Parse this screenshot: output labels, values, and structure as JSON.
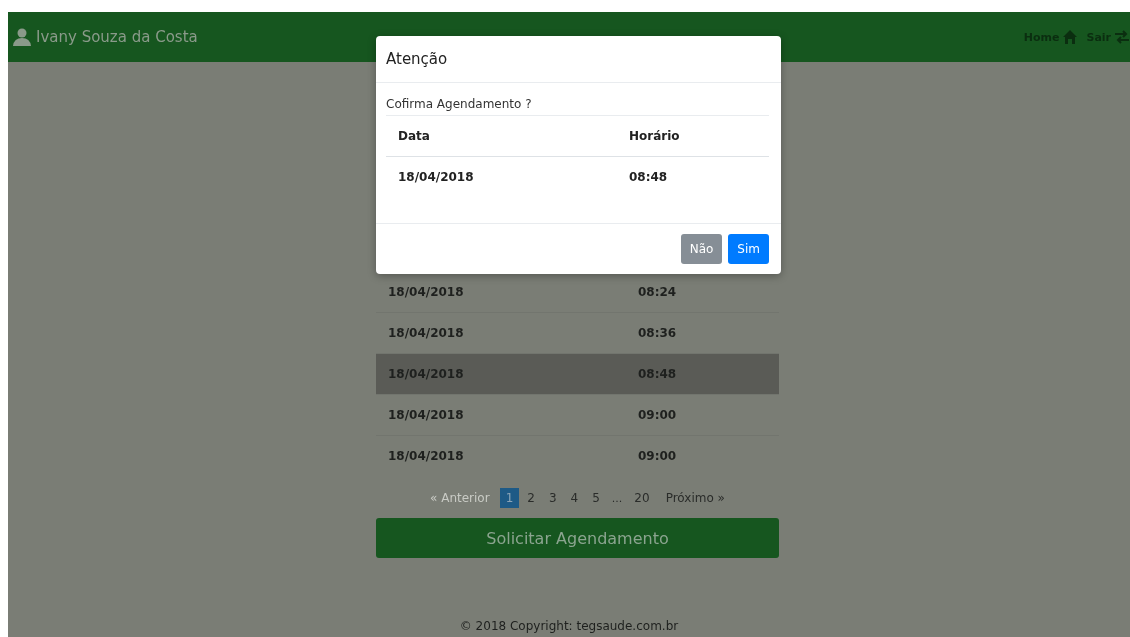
{
  "navbar": {
    "user": "Ivany Souza da Costa",
    "links": [
      {
        "label": "Home",
        "kind": "home"
      },
      {
        "label": "Sair",
        "kind": "exit"
      }
    ]
  },
  "table": {
    "rows": [
      {
        "date": "18/04/2018",
        "time": "08:24",
        "selected": false
      },
      {
        "date": "18/04/2018",
        "time": "08:36",
        "selected": false
      },
      {
        "date": "18/04/2018",
        "time": "08:48",
        "selected": true
      },
      {
        "date": "18/04/2018",
        "time": "09:00",
        "selected": false
      },
      {
        "date": "18/04/2018",
        "time": "09:00",
        "selected": false
      }
    ]
  },
  "pagination": [
    {
      "label": "« Anterior",
      "kind": "nav",
      "disabled": true,
      "selected": false
    },
    {
      "label": "1",
      "kind": "page",
      "selected": true
    },
    {
      "label": "2",
      "kind": "page",
      "selected": false
    },
    {
      "label": "3",
      "kind": "page",
      "selected": false
    },
    {
      "label": "4",
      "kind": "page",
      "selected": false
    },
    {
      "label": "5",
      "kind": "page",
      "selected": false
    },
    {
      "label": "...",
      "kind": "ellipsis",
      "selected": false
    },
    {
      "label": "20",
      "kind": "page",
      "selected": false
    },
    {
      "label": "Próximo »",
      "kind": "nav",
      "disabled": false,
      "selected": false
    }
  ],
  "submit_button": "Solicitar Agendamento",
  "footer": "© 2018 Copyright: tegsaude.com.br",
  "modal": {
    "title": "Atenção",
    "message": "Cofirma Agendamento ?",
    "columns": [
      "Data",
      "Horário"
    ],
    "row": [
      "18/04/2018",
      "08:48"
    ],
    "buttons": [
      {
        "label": "Não",
        "kind": "secondary"
      },
      {
        "label": "Sim",
        "kind": "primary"
      }
    ]
  }
}
